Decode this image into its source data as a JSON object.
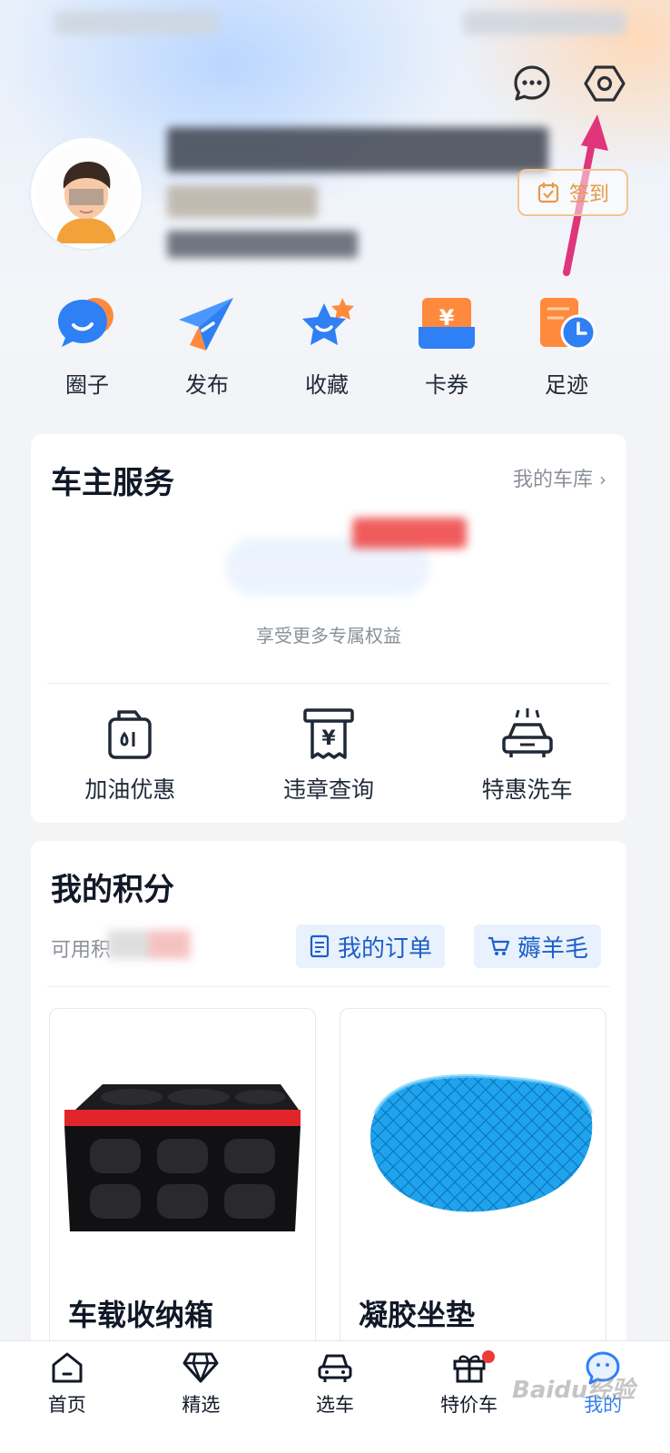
{
  "quick_actions": [
    {
      "label": "圈子",
      "icon": "chat-bubbles-icon"
    },
    {
      "label": "发布",
      "icon": "paper-plane-icon"
    },
    {
      "label": "收藏",
      "icon": "star-icon"
    },
    {
      "label": "卡券",
      "icon": "coupon-icon"
    },
    {
      "label": "足迹",
      "icon": "history-clock-icon"
    }
  ],
  "profile": {
    "signin_label": "签到"
  },
  "owner_service": {
    "title": "车主服务",
    "garage_link": "我的车库",
    "hint": "享受更多专属权益",
    "services": [
      {
        "label": "加油优惠",
        "icon": "fuel-can-icon"
      },
      {
        "label": "违章查询",
        "icon": "receipt-yen-icon"
      },
      {
        "label": "特惠洗车",
        "icon": "car-wash-icon"
      }
    ]
  },
  "points": {
    "title": "我的积分",
    "available_label": "可用积",
    "orders_chip": "我的订单",
    "deals_chip": "薅羊毛",
    "products": [
      {
        "name": "车载收纳箱",
        "image": "storage-box"
      },
      {
        "name": "凝胶坐垫",
        "image": "gel-seat-cushion"
      }
    ]
  },
  "tabs": [
    {
      "label": "首页",
      "icon": "home-icon",
      "active": false
    },
    {
      "label": "精选",
      "icon": "diamond-icon",
      "active": false
    },
    {
      "label": "选车",
      "icon": "car-icon",
      "active": false
    },
    {
      "label": "特价车",
      "icon": "gift-icon",
      "active": false,
      "badge": true
    },
    {
      "label": "我的",
      "icon": "profile-bubble-icon",
      "active": true
    }
  ],
  "watermark": "Baidu经验",
  "colors": {
    "accent": "#2f7ff5",
    "signin": "#e79a48",
    "badge": "#ef3a3a",
    "annotation_arrow": "#e0357a"
  }
}
